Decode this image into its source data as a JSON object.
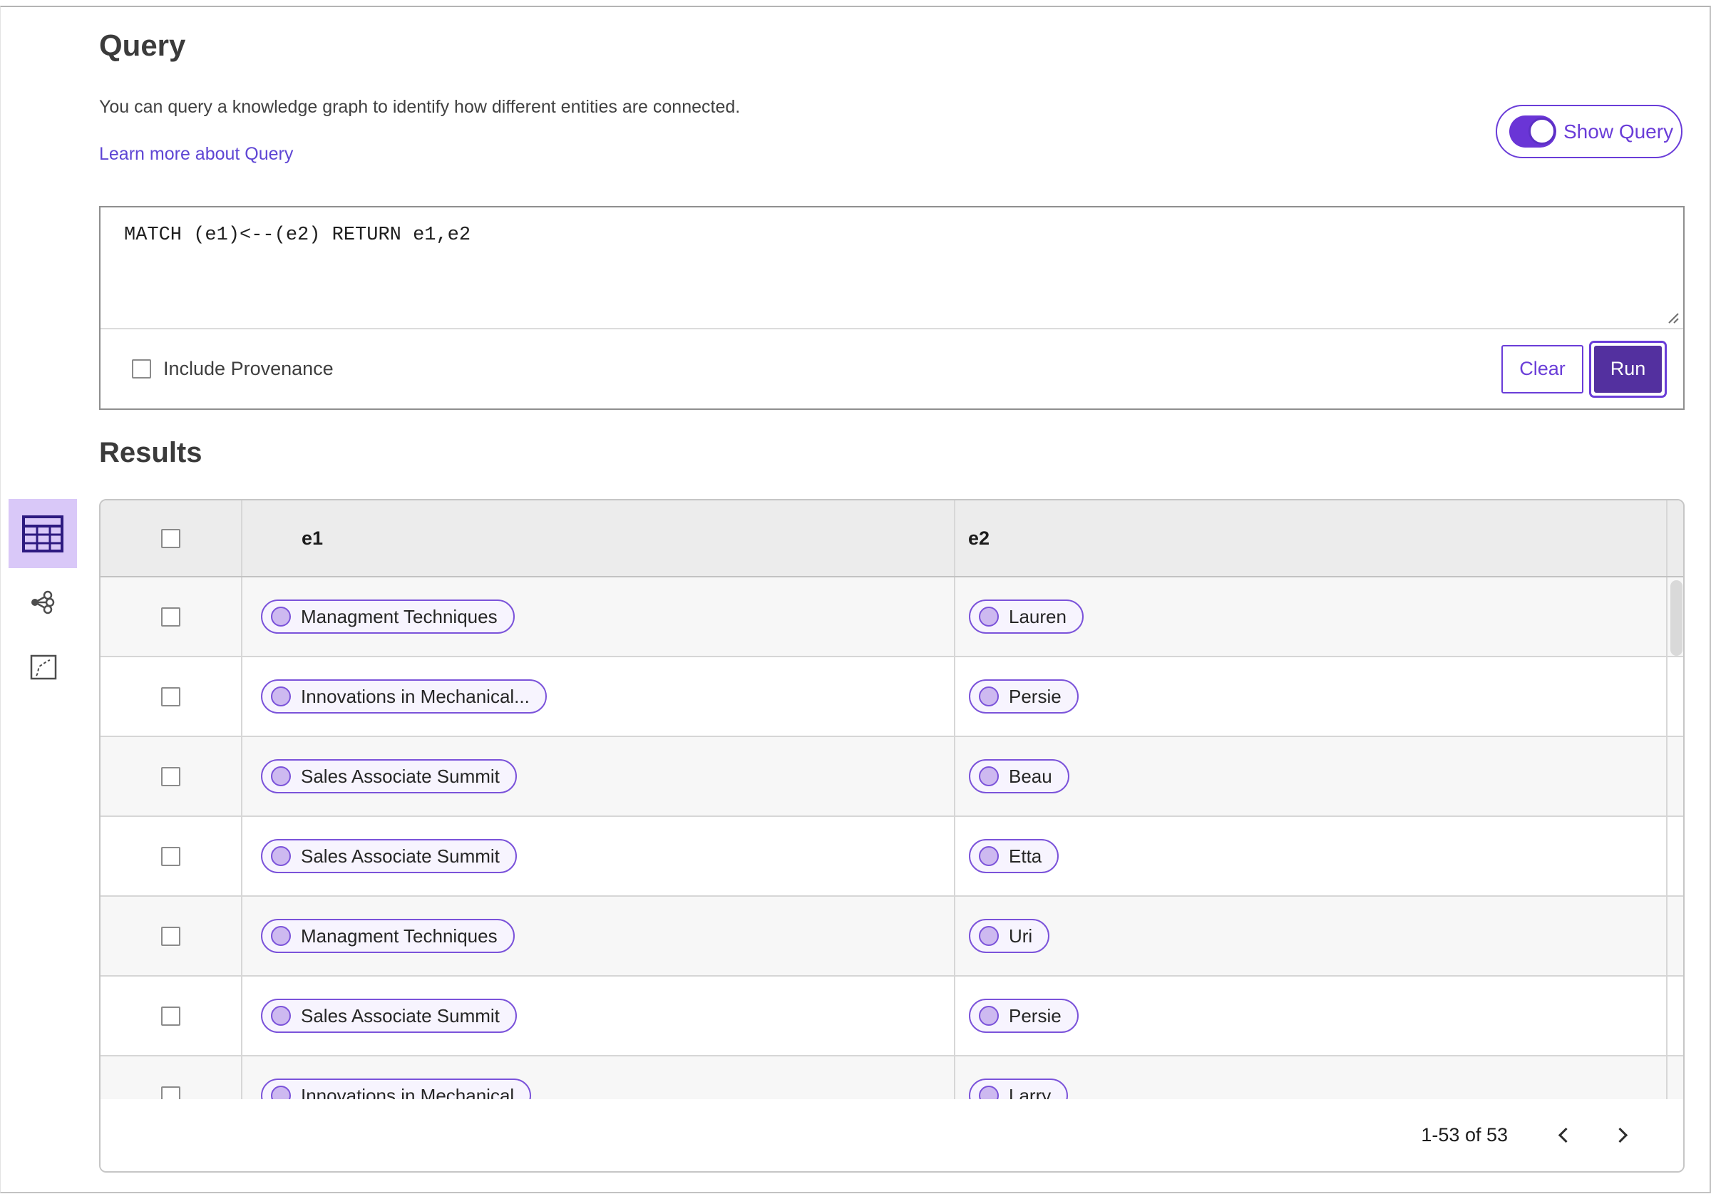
{
  "header": {
    "title": "Query",
    "description": "You can query a knowledge graph to identify how different entities are connected.",
    "learn_more": "Learn more about Query",
    "show_query_label": "Show Query",
    "show_query_on": true
  },
  "query_editor": {
    "text": "MATCH (e1)<--(e2) RETURN e1,e2",
    "include_provenance_label": "Include Provenance",
    "include_provenance_checked": false,
    "clear_label": "Clear",
    "run_label": "Run"
  },
  "results": {
    "title": "Results",
    "view_switcher": [
      {
        "name": "table-view-icon",
        "selected": true
      },
      {
        "name": "graph-view-icon",
        "selected": false
      },
      {
        "name": "expand-view-icon",
        "selected": false
      }
    ],
    "columns": [
      "e1",
      "e2"
    ],
    "rows": [
      {
        "e1": "Managment Techniques",
        "e2": "Lauren"
      },
      {
        "e1": "Innovations in Mechanical...",
        "e2": "Persie"
      },
      {
        "e1": "Sales Associate Summit",
        "e2": "Beau"
      },
      {
        "e1": "Sales Associate Summit",
        "e2": "Etta"
      },
      {
        "e1": "Managment Techniques",
        "e2": "Uri"
      },
      {
        "e1": "Sales Associate Summit",
        "e2": "Persie"
      },
      {
        "e1": "Innovations in Mechanical",
        "e2": "Larry"
      }
    ],
    "pagination": {
      "label": "1-53 of 53",
      "prev_icon": "chevron-left-icon",
      "next_icon": "chevron-right-icon"
    }
  },
  "icons": {
    "resize_handle": "resize-grip-icon",
    "entity_dot": "entity-node-icon"
  },
  "colors": {
    "accent_purple": "#6a3dd8",
    "run_button_fill": "#53309f",
    "selected_view_bg": "#d9c8f8",
    "selected_view_icon": "#2d1a80",
    "pill_border": "#7b53da",
    "pill_bg": "#f7f4fe",
    "pill_dot_fill": "#cdb9f0",
    "table_header_bg": "#ececec",
    "row_alt_bg": "#f7f7f7",
    "link_color": "#5f46d4"
  }
}
